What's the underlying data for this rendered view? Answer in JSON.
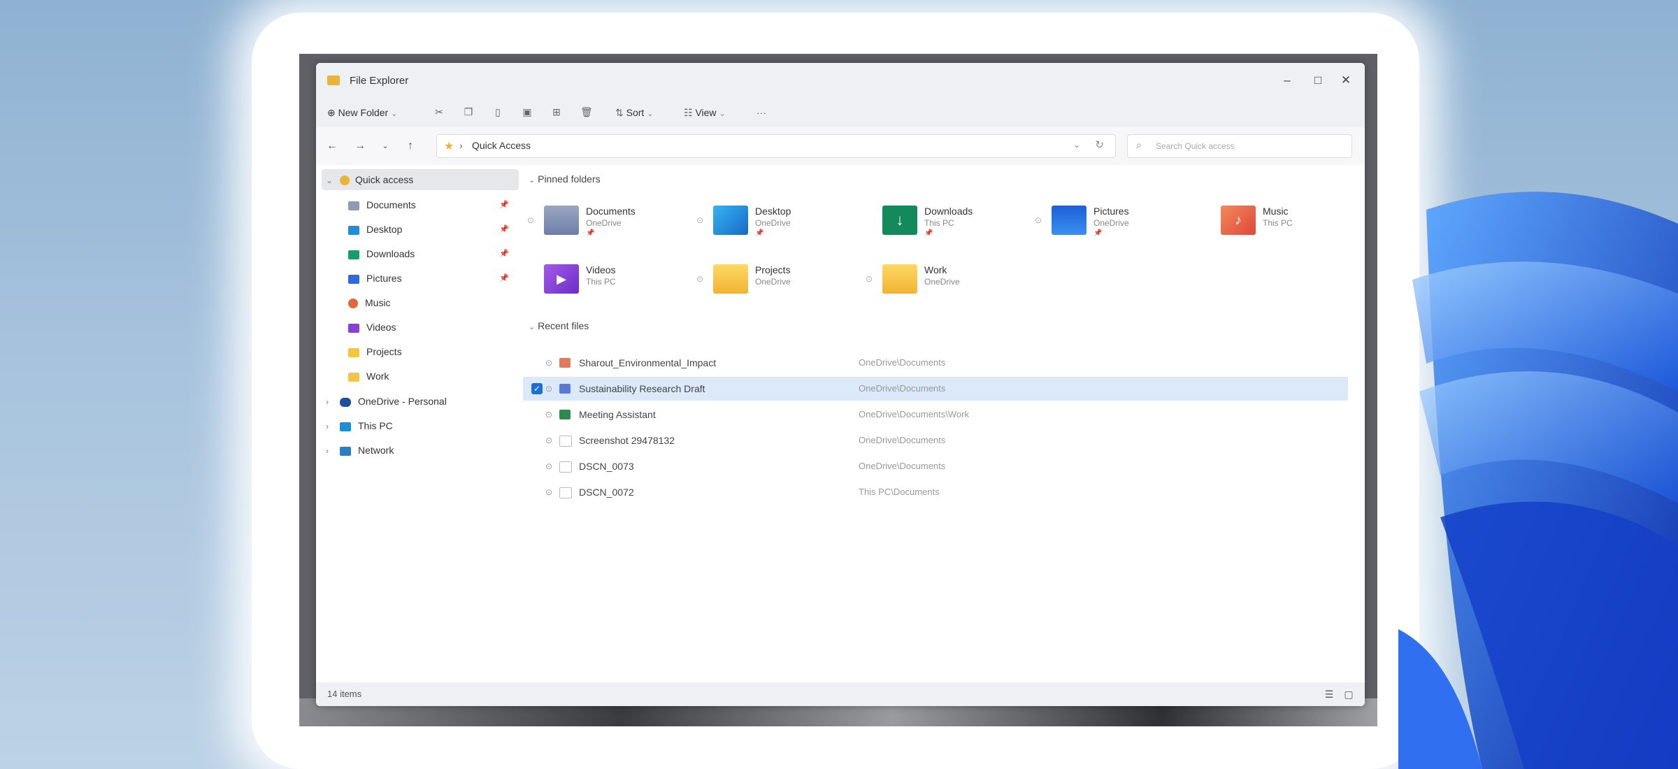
{
  "window": {
    "title": "File Explorer",
    "controls": {
      "minimize": "–",
      "maximize": "□",
      "close": "✕"
    }
  },
  "toolbar": {
    "new_folder": "New Folder",
    "sort": "Sort",
    "view": "View",
    "more": "···"
  },
  "navigation": {
    "breadcrumb": [
      "Quick Access"
    ],
    "search_placeholder": "Search Quick access"
  },
  "sidebar": {
    "quick_access": "Quick access",
    "quick_items": [
      {
        "label": "Documents",
        "pinned": true
      },
      {
        "label": "Desktop",
        "pinned": true
      },
      {
        "label": "Downloads",
        "pinned": true
      },
      {
        "label": "Pictures",
        "pinned": true
      },
      {
        "label": "Music",
        "pinned": false
      },
      {
        "label": "Videos",
        "pinned": false
      },
      {
        "label": "Projects",
        "pinned": false
      },
      {
        "label": "Work",
        "pinned": false
      }
    ],
    "roots": [
      "OneDrive - Personal",
      "This PC",
      "Network"
    ]
  },
  "pinned": {
    "heading": "Pinned folders",
    "folders": [
      {
        "name": "Documents",
        "location": "OneDrive"
      },
      {
        "name": "Desktop",
        "location": "OneDrive"
      },
      {
        "name": "Downloads",
        "location": "This PC"
      },
      {
        "name": "Pictures",
        "location": "OneDrive"
      },
      {
        "name": "Music",
        "location": "This PC"
      },
      {
        "name": "Videos",
        "location": "This PC"
      },
      {
        "name": "Projects",
        "location": "OneDrive"
      },
      {
        "name": "Work",
        "location": "OneDrive"
      }
    ]
  },
  "recent": {
    "heading": "Recent files",
    "files": [
      {
        "name": "Sharout_Environmental_Impact",
        "location": "OneDrive\\Documents",
        "selected": false
      },
      {
        "name": "Sustainability Research Draft",
        "location": "OneDrive\\Documents",
        "selected": true
      },
      {
        "name": "Meeting Assistant",
        "location": "OneDrive\\Documents\\Work",
        "selected": false
      },
      {
        "name": "Screenshot 29478132",
        "location": "OneDrive\\Documents",
        "selected": false
      },
      {
        "name": "DSCN_0073",
        "location": "OneDrive\\Documents",
        "selected": false
      },
      {
        "name": "DSCN_0072",
        "location": "This PC\\Documents",
        "selected": false
      }
    ]
  },
  "status": {
    "items": "14 items"
  },
  "colors": {
    "accent": "#1e6fd1",
    "selection": "#dce9f8",
    "folder": "#f5c542"
  }
}
